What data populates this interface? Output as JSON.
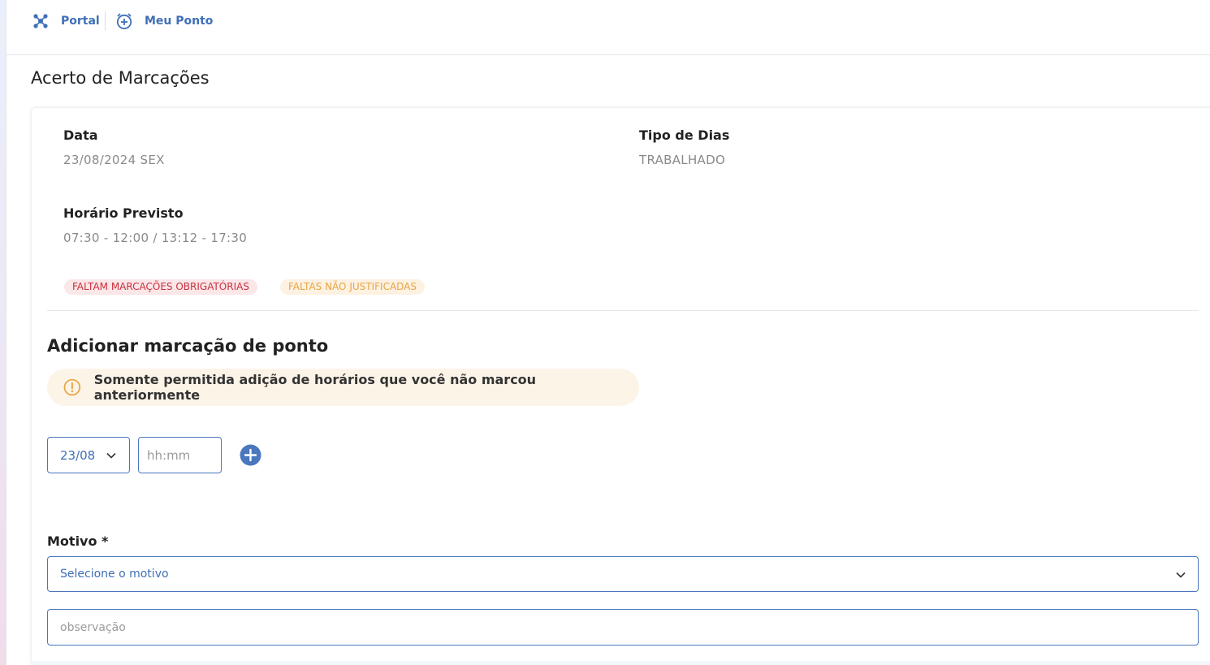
{
  "breadcrumb": {
    "portal_label": "Portal",
    "meu_ponto_label": "Meu Ponto"
  },
  "page": {
    "title": "Acerto de Marcações"
  },
  "details": {
    "data_label": "Data",
    "data_value": "23/08/2024 SEX",
    "tipo_label": "Tipo de Dias",
    "tipo_value": "TRABALHADO",
    "horario_label": "Horário Previsto",
    "horario_value": "07:30 - 12:00 / 13:12 - 17:30"
  },
  "badges": {
    "faltam": "FALTAM MARCAÇÕES OBRIGATÓRIAS",
    "faltas": "FALTAS NÃO JUSTIFICADAS"
  },
  "add_section": {
    "title": "Adicionar marcação de ponto",
    "alert_text": "Somente permitida adição de horários que você não marcou anteriormente",
    "date_value": "23/08",
    "time_placeholder": "hh:mm"
  },
  "motivo": {
    "label": "Motivo *",
    "select_placeholder": "Selecione o motivo",
    "obs_placeholder": "observação"
  },
  "colors": {
    "accent": "#3f6fb6",
    "danger": "#c9303e",
    "warning": "#e7a645"
  }
}
